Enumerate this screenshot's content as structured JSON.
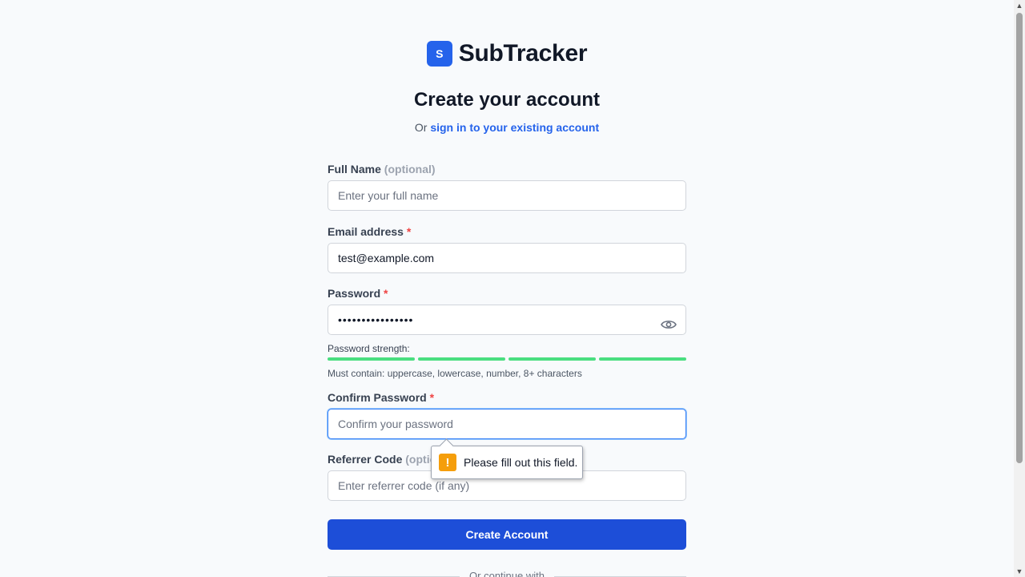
{
  "brand": {
    "logo_letter": "S",
    "name": "SubTracker"
  },
  "heading": {
    "title": "Create your account",
    "prefix": "Or",
    "link": "sign in to your existing account"
  },
  "form": {
    "full_name": {
      "label": "Full Name",
      "optional": "(optional)",
      "placeholder": "Enter your full name",
      "value": ""
    },
    "email": {
      "label": "Email address",
      "required_mark": "*",
      "value": "test@example.com"
    },
    "password": {
      "label": "Password",
      "required_mark": "*",
      "masked_value": "••••••••••••••••",
      "toggle_icon": "eye-icon"
    },
    "strength": {
      "label": "Password strength:",
      "segments_filled": 4,
      "segments_total": 4,
      "color": "#4ade80",
      "hint": "Must contain: uppercase, lowercase, number, 8+ characters"
    },
    "confirm_password": {
      "label": "Confirm Password",
      "required_mark": "*",
      "placeholder": "Confirm your password",
      "value": ""
    },
    "referrer": {
      "label": "Referrer Code",
      "optional": "(optional)",
      "placeholder": "Enter referrer code (if any)",
      "value": ""
    },
    "submit_label": "Create Account",
    "divider_text": "Or continue with"
  },
  "validation_tooltip": {
    "icon": "warning-icon",
    "icon_glyph": "!",
    "message": "Please fill out this field."
  },
  "colors": {
    "primary": "#1d4ed8",
    "link": "#2563eb",
    "required": "#ef4444",
    "warning": "#f59e0b"
  }
}
